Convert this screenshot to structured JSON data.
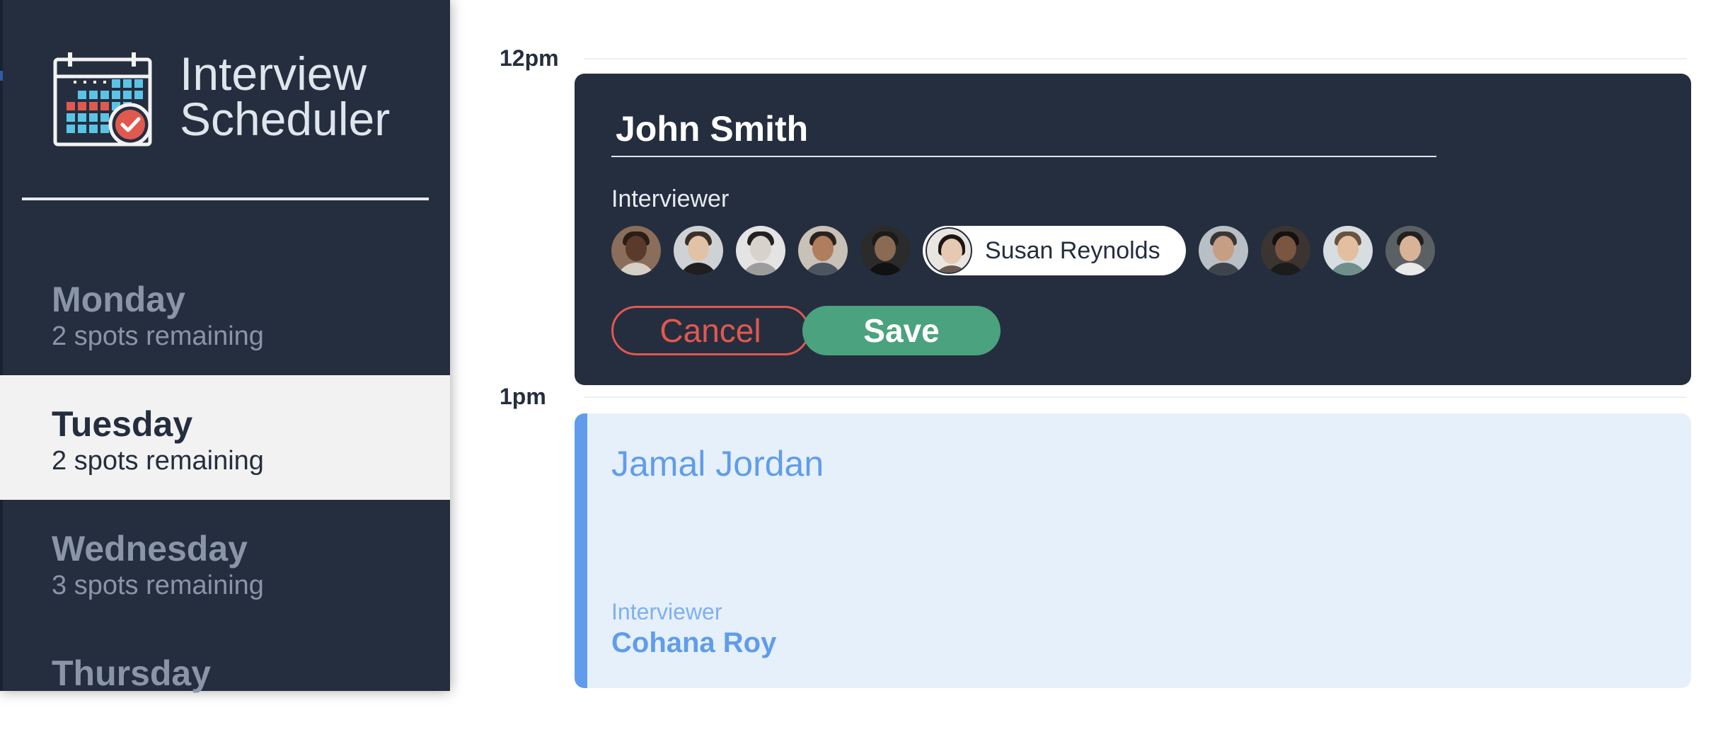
{
  "app": {
    "title_line1": "Interview",
    "title_line2": "Scheduler"
  },
  "days": [
    {
      "name": "Monday",
      "spots": "2 spots remaining",
      "selected": false
    },
    {
      "name": "Tuesday",
      "spots": "2 spots remaining",
      "selected": true
    },
    {
      "name": "Wednesday",
      "spots": "3 spots remaining",
      "selected": false
    },
    {
      "name": "Thursday",
      "spots": "",
      "selected": false
    }
  ],
  "schedule": {
    "times": [
      "12pm",
      "1pm"
    ]
  },
  "form": {
    "student_value": "John Smith",
    "interviewer_heading": "Interviewer",
    "selected_interviewer": "Susan Reynolds",
    "cancel_label": "Cancel",
    "save_label": "Save",
    "interviewer_avatars": [
      "avatar",
      "avatar",
      "avatar",
      "avatar",
      "avatar",
      "avatar",
      "avatar",
      "avatar",
      "avatar",
      "avatar"
    ]
  },
  "appointment": {
    "student": "Jamal Jordan",
    "interviewer_heading": "Interviewer",
    "interviewer": "Cohana Roy"
  },
  "colors": {
    "sidebar_bg": "#252e3f",
    "cancel_red": "#e0594f",
    "save_green": "#4ba27f",
    "appointment_blue": "#609ceb",
    "appointment_bg": "#e6f0fb"
  }
}
